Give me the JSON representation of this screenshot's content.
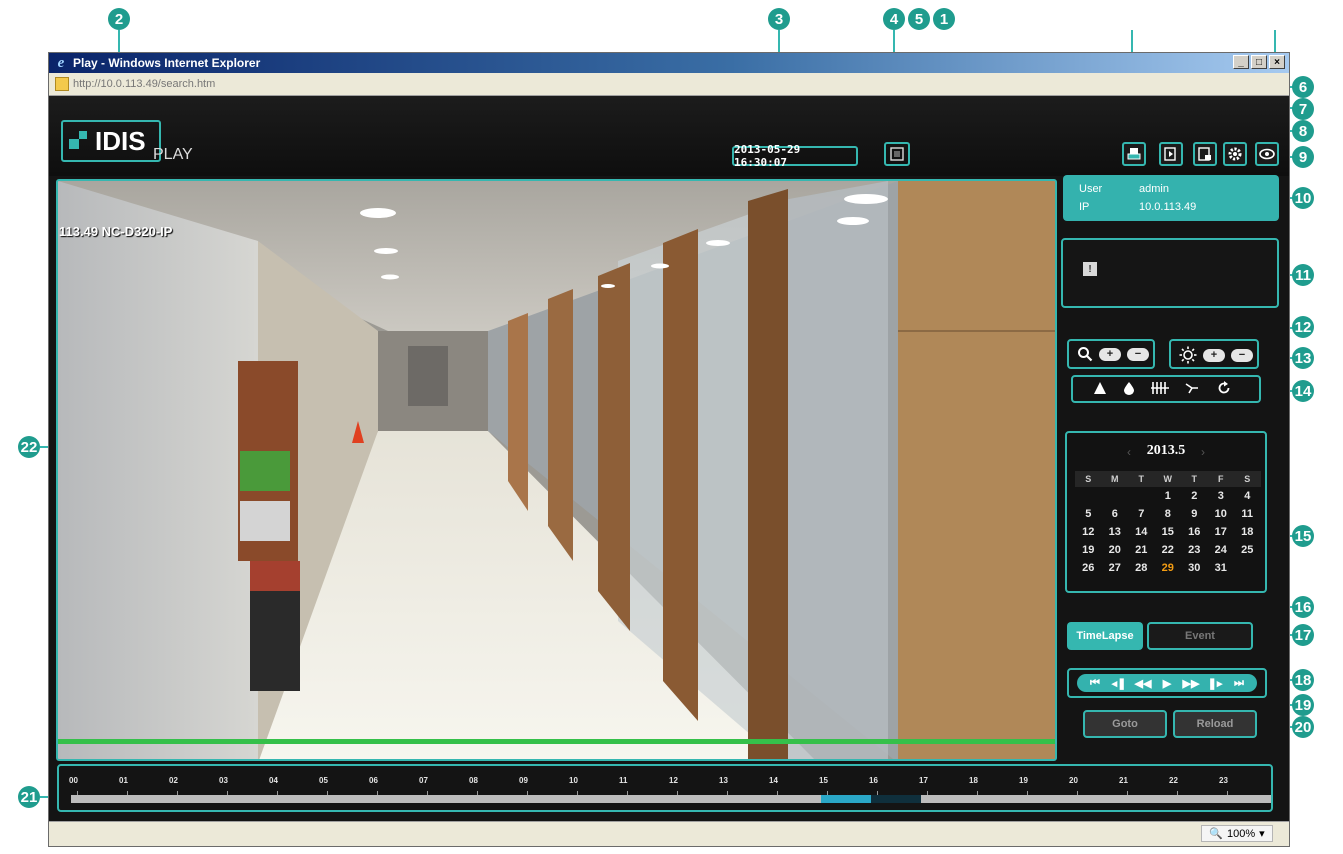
{
  "browser": {
    "title": "Play - Windows Internet Explorer",
    "url": "http://10.0.113.49/search.htm",
    "zoom": "100%",
    "window_buttons": [
      "_",
      "□",
      "×"
    ]
  },
  "header": {
    "logo_text": "IDIS",
    "logo_suffix": "PLAY",
    "datetime": "2013-05-29 16:30:07"
  },
  "video": {
    "camera_label": "113.49 NC-D320-IP",
    "progress": 1.0
  },
  "user_info": {
    "user_label": "User",
    "user_value": "admin",
    "ip_label": "IP",
    "ip_value": "10.0.113.49"
  },
  "event_indicator": {
    "icon_text": "!"
  },
  "calendar": {
    "month": "2013.5",
    "prev": "‹",
    "next": "›",
    "weekdays": [
      "S",
      "M",
      "T",
      "W",
      "T",
      "F",
      "S"
    ],
    "weeks": [
      [
        "",
        "",
        "",
        "1",
        "2",
        "3",
        "4"
      ],
      [
        "5",
        "6",
        "7",
        "8",
        "9",
        "10",
        "11"
      ],
      [
        "12",
        "13",
        "14",
        "15",
        "16",
        "17",
        "18"
      ],
      [
        "19",
        "20",
        "21",
        "22",
        "23",
        "24",
        "25"
      ],
      [
        "26",
        "27",
        "28",
        "29",
        "30",
        "31",
        ""
      ]
    ],
    "selected": "29"
  },
  "tabs": {
    "timelapse": "TimeLapse",
    "event": "Event"
  },
  "buttons": {
    "goto": "Goto",
    "reload": "Reload"
  },
  "zoom_ctrl": {
    "plus": "+",
    "minus": "−"
  },
  "bright_ctrl": {
    "plus": "+",
    "minus": "−"
  },
  "playback_icons": [
    "⏮",
    "◂❚",
    "◀◀",
    "▶",
    "▶▶",
    "❚▸",
    "⏭"
  ],
  "timeline": {
    "hours": [
      "00",
      "01",
      "02",
      "03",
      "04",
      "05",
      "06",
      "07",
      "08",
      "09",
      "10",
      "11",
      "12",
      "13",
      "14",
      "15",
      "16",
      "17",
      "18",
      "19",
      "20",
      "21",
      "22",
      "23"
    ],
    "recorded_segments": [
      {
        "start": 15.0,
        "end": 16.0,
        "color": "#2aa7c7"
      },
      {
        "start": 16.0,
        "end": 17.0,
        "color": "#0f2f3c"
      }
    ]
  },
  "callouts": [
    "1",
    "2",
    "3",
    "4",
    "5",
    "6",
    "7",
    "8",
    "9",
    "10",
    "11",
    "12",
    "13",
    "14",
    "15",
    "16",
    "17",
    "18",
    "19",
    "20",
    "21",
    "22"
  ],
  "colors": {
    "accent": "#35b7b0",
    "today": "#f39c12"
  }
}
